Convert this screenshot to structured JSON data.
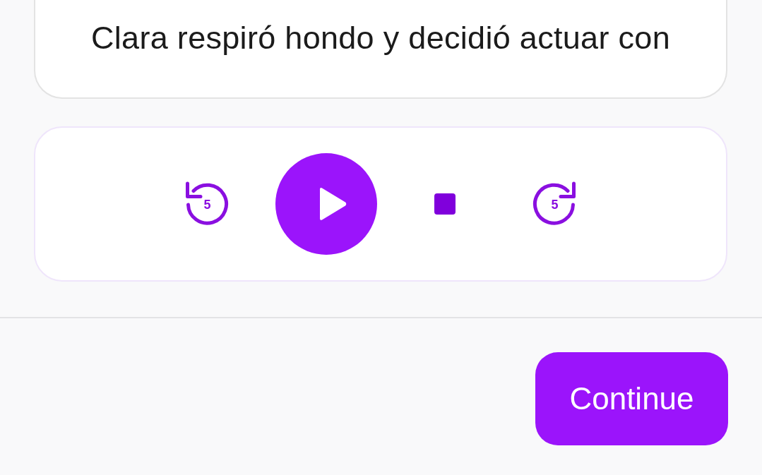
{
  "reading_card": {
    "text": "Clara respiró hondo y decidió actuar con"
  },
  "player": {
    "controls": [
      {
        "kind": "rewind",
        "label": "5"
      },
      {
        "kind": "play"
      },
      {
        "kind": "stop"
      },
      {
        "kind": "forward",
        "label": "5"
      }
    ]
  },
  "footer": {
    "continue_button": {
      "label": "Continue"
    }
  }
}
